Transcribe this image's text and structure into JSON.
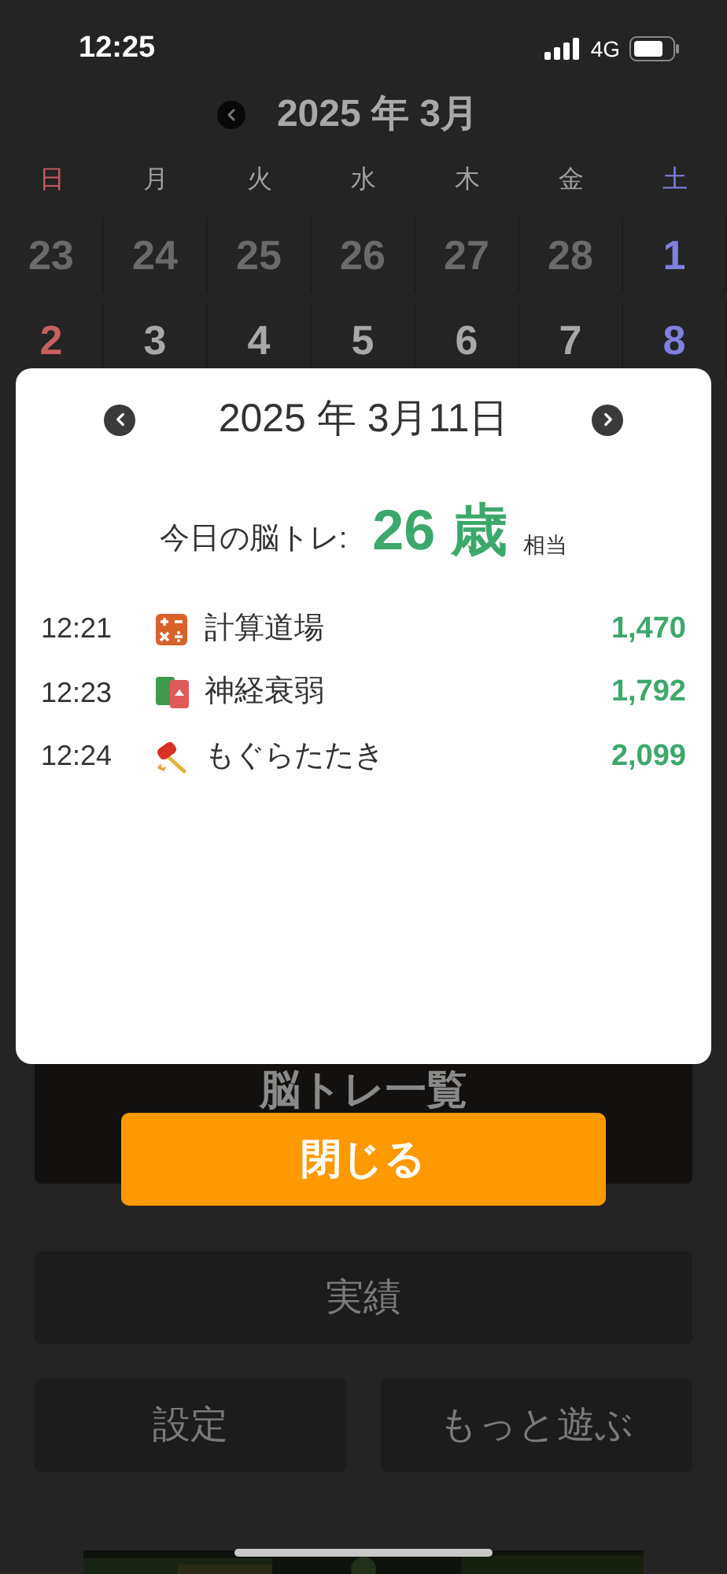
{
  "status_bar": {
    "time": "12:25",
    "network": "4G"
  },
  "calendar": {
    "title": "2025 年 3月",
    "weekdays": [
      {
        "label": "日",
        "kind": "sunday"
      },
      {
        "label": "月",
        "kind": "weekday"
      },
      {
        "label": "火",
        "kind": "weekday"
      },
      {
        "label": "水",
        "kind": "weekday"
      },
      {
        "label": "木",
        "kind": "weekday"
      },
      {
        "label": "金",
        "kind": "weekday"
      },
      {
        "label": "土",
        "kind": "saturday"
      }
    ],
    "weeks": [
      [
        {
          "day": "23",
          "outside_month": true
        },
        {
          "day": "24",
          "outside_month": true
        },
        {
          "day": "25",
          "outside_month": true
        },
        {
          "day": "26",
          "outside_month": true
        },
        {
          "day": "27",
          "outside_month": true
        },
        {
          "day": "28",
          "outside_month": true
        },
        {
          "day": "1",
          "outside_month": false
        }
      ],
      [
        {
          "day": "2",
          "outside_month": false
        },
        {
          "day": "3",
          "outside_month": false
        },
        {
          "day": "4",
          "outside_month": false
        },
        {
          "day": "5",
          "outside_month": false
        },
        {
          "day": "6",
          "outside_month": false
        },
        {
          "day": "7",
          "outside_month": false
        },
        {
          "day": "8",
          "outside_month": false
        }
      ]
    ]
  },
  "banner": {
    "title": "脳トレ一覧"
  },
  "menu_buttons": [
    {
      "label": "実績"
    },
    {
      "label": "設定"
    },
    {
      "label": "もっと遊ぶ"
    }
  ],
  "dialog": {
    "date": "2025 年 3月11日",
    "summary_label": "今日の脳トレ:",
    "age": "26 歳",
    "age_suffix": "相当",
    "records": [
      {
        "time": "12:21",
        "game": "計算道場",
        "kind": "calculator",
        "score": "1,470"
      },
      {
        "time": "12:23",
        "game": "神経衰弱",
        "kind": "cards",
        "score": "1,792"
      },
      {
        "time": "12:24",
        "game": "もぐらたたき",
        "kind": "hammer",
        "score": "2,099"
      }
    ],
    "close_button": "閉じる"
  }
}
